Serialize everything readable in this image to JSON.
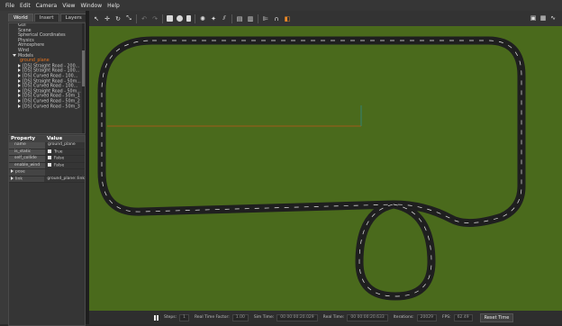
{
  "menu": [
    "File",
    "Edit",
    "Camera",
    "View",
    "Window",
    "Help"
  ],
  "tabs": [
    {
      "label": "World",
      "active": true
    },
    {
      "label": "Insert",
      "active": false
    },
    {
      "label": "Layers",
      "active": false
    }
  ],
  "tree": {
    "top_items": [
      "GUI",
      "Scene",
      "Spherical Coordinates",
      "Physics",
      "Atmosphere",
      "Wind"
    ],
    "models_label": "Models",
    "models": [
      {
        "label": "ground_plane",
        "selected": true
      },
      {
        "label": "[DS] Straight Road - 200...",
        "selected": false
      },
      {
        "label": "[DS] Straight Road - 100...",
        "selected": false
      },
      {
        "label": "[DS] Curved Road - 100...",
        "selected": false
      },
      {
        "label": "[DS] Straight Road - 50m...",
        "selected": false
      },
      {
        "label": "[DS] Curved Road - 100...",
        "selected": false
      },
      {
        "label": "[DS] Straight Road - 50m...",
        "selected": false
      },
      {
        "label": "[DS] Curved Road - 50m_1",
        "selected": false
      },
      {
        "label": "[DS] Curved Road - 50m_2",
        "selected": false
      },
      {
        "label": "[DS] Curved Road - 50m_3",
        "selected": false
      }
    ]
  },
  "properties": {
    "header_property": "Property",
    "header_value": "Value",
    "rows": [
      {
        "key": "name",
        "value": "ground_plane",
        "checkbox": false
      },
      {
        "key": "is_static",
        "value": "True",
        "checkbox": true
      },
      {
        "key": "self_collide",
        "value": "False",
        "checkbox": true
      },
      {
        "key": "enable_wind",
        "value": "False",
        "checkbox": true
      }
    ],
    "expandables": [
      {
        "key": "pose",
        "value": ""
      },
      {
        "key": "link",
        "value": "ground_plane::link"
      }
    ]
  },
  "status": {
    "steps_label": "Steps:",
    "steps_value": "1",
    "real_time_factor_label": "Real Time Factor:",
    "real_time_factor": "1.00",
    "sim_time_label": "Sim Time:",
    "sim_time": "00 00:00:20.029",
    "real_time_label": "Real Time:",
    "real_time": "00 00:00:20.633",
    "iterations_label": "Iterations:",
    "iterations": "20029",
    "fps_label": "FPS:",
    "fps": "62.49",
    "reset_label": "Reset Time"
  },
  "colors": {
    "ground": "#4a6a1c",
    "road": "#1f1f1f",
    "road_marking": "#e6e6e6",
    "selection": "#e8731c"
  }
}
